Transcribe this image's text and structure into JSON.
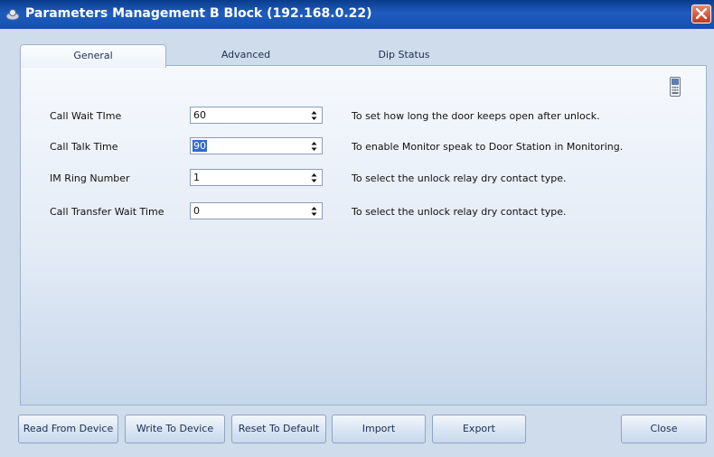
{
  "window": {
    "title": "Parameters Management B Block (192.168.0.22)",
    "title_icon": "app-icon",
    "close_icon": "close-icon"
  },
  "tabs": [
    {
      "label": "General",
      "active": true
    },
    {
      "label": "Advanced",
      "active": false
    },
    {
      "label": "Dip Status",
      "active": false
    }
  ],
  "params": [
    {
      "label": "Call Wait TIme",
      "value": "60",
      "description": "To set how long the door keeps open after unlock."
    },
    {
      "label": "Call Talk Time",
      "value": "90",
      "description": "To enable Monitor speak to Door Station in Monitoring."
    },
    {
      "label": "IM Ring Number",
      "value": "1",
      "description": "To select the unlock relay dry contact type."
    },
    {
      "label": "Call Transfer Wait Time",
      "value": "0",
      "description": "To select the unlock relay dry contact type."
    }
  ],
  "buttons": {
    "read": "Read From Device",
    "write": "Write To Device",
    "reset": "Reset To Default",
    "import": "Import",
    "export": "Export",
    "close": "Close"
  },
  "colors": {
    "titlebar": "#1450ad",
    "panel_bg": "#e3ebf6",
    "selection": "#316ac5",
    "close_button": "#c2381b"
  }
}
